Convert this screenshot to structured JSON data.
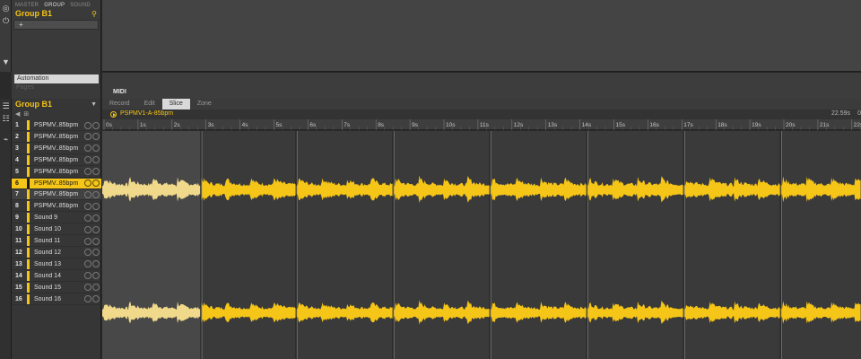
{
  "browser": {
    "tabs": [
      {
        "label": "MASTER",
        "active": false
      },
      {
        "label": "GROUP",
        "active": true
      },
      {
        "label": "SOUND",
        "active": false
      }
    ],
    "group_title": "Group B1",
    "add_label": "+"
  },
  "modulation": {
    "automation_label": "Automation",
    "pages_label": "Pages"
  },
  "midi_label": "MIDI",
  "group_list": {
    "title": "Group B1",
    "sounds": [
      {
        "num": "1",
        "name": "PSPMV..85bpm"
      },
      {
        "num": "2",
        "name": "PSPMV..85bpm"
      },
      {
        "num": "3",
        "name": "PSPMV..85bpm"
      },
      {
        "num": "4",
        "name": "PSPMV..85bpm"
      },
      {
        "num": "5",
        "name": "PSPMV..85bpm"
      },
      {
        "num": "6",
        "name": "PSPMV..85bpm"
      },
      {
        "num": "7",
        "name": "PSPMV..85bpm"
      },
      {
        "num": "8",
        "name": "PSPMV..85bpm"
      },
      {
        "num": "9",
        "name": "Sound 9"
      },
      {
        "num": "10",
        "name": "Sound 10"
      },
      {
        "num": "11",
        "name": "Sound 11"
      },
      {
        "num": "12",
        "name": "Sound 12"
      },
      {
        "num": "13",
        "name": "Sound 13"
      },
      {
        "num": "14",
        "name": "Sound 14"
      },
      {
        "num": "15",
        "name": "Sound 15"
      },
      {
        "num": "16",
        "name": "Sound 16"
      }
    ],
    "selected_index": 5
  },
  "editor": {
    "tabs": [
      {
        "label": "Record",
        "active": false
      },
      {
        "label": "Edit",
        "active": false
      },
      {
        "label": "Slice",
        "active": true
      },
      {
        "label": "Zone",
        "active": false
      }
    ],
    "sample_name": "PSPMV1-A-85bpm",
    "sample_length": "22.59s",
    "sample_length_extra": "0",
    "ruler_labels": [
      "0s",
      "1s",
      "2s",
      "3s",
      "4s",
      "5s",
      "6s",
      "7s",
      "8s",
      "9s",
      "10s",
      "11s",
      "12s",
      "13s",
      "14s",
      "15s",
      "16s",
      "17s",
      "18s",
      "19s",
      "20s",
      "21s",
      "22s"
    ],
    "slice_points_s": [
      2.85,
      5.65,
      8.5,
      11.35,
      14.2,
      17.05,
      19.9,
      22.75
    ],
    "colors": {
      "waveform": "#f5c518",
      "waveform_dim": "#f0d98a",
      "accent": "#f5c518"
    }
  }
}
